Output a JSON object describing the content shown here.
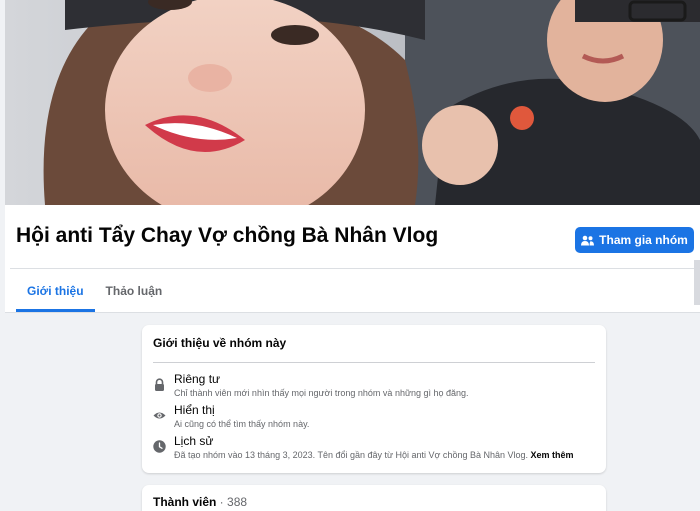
{
  "group": {
    "name": "Hội anti Tẩy Chay Vợ chồng Bà Nhân Vlog",
    "join_label": "Tham gia nhóm"
  },
  "tabs": [
    {
      "label": "Giới thiệu",
      "active": true
    },
    {
      "label": "Thảo luận",
      "active": false
    }
  ],
  "about": {
    "title": "Giới thiệu về nhóm này",
    "items": [
      {
        "icon": "lock-icon",
        "title": "Riêng tư",
        "desc": "Chỉ thành viên mới nhìn thấy mọi người trong nhóm và những gì họ đăng."
      },
      {
        "icon": "eye-icon",
        "title": "Hiển thị",
        "desc": "Ai cũng có thể tìm thấy nhóm này."
      },
      {
        "icon": "clock-icon",
        "title": "Lịch sử",
        "desc": "Đã tạo nhóm vào 13 tháng 3, 2023. Tên đổi gần đây từ Hội anti Vợ chồng Bà Nhân Vlog.",
        "more": "Xem thêm"
      }
    ]
  },
  "members": {
    "label": "Thành viên",
    "separator": " · ",
    "count": "388"
  },
  "colors": {
    "accent": "#1b74e4",
    "page_bg": "#f0f2f5"
  }
}
